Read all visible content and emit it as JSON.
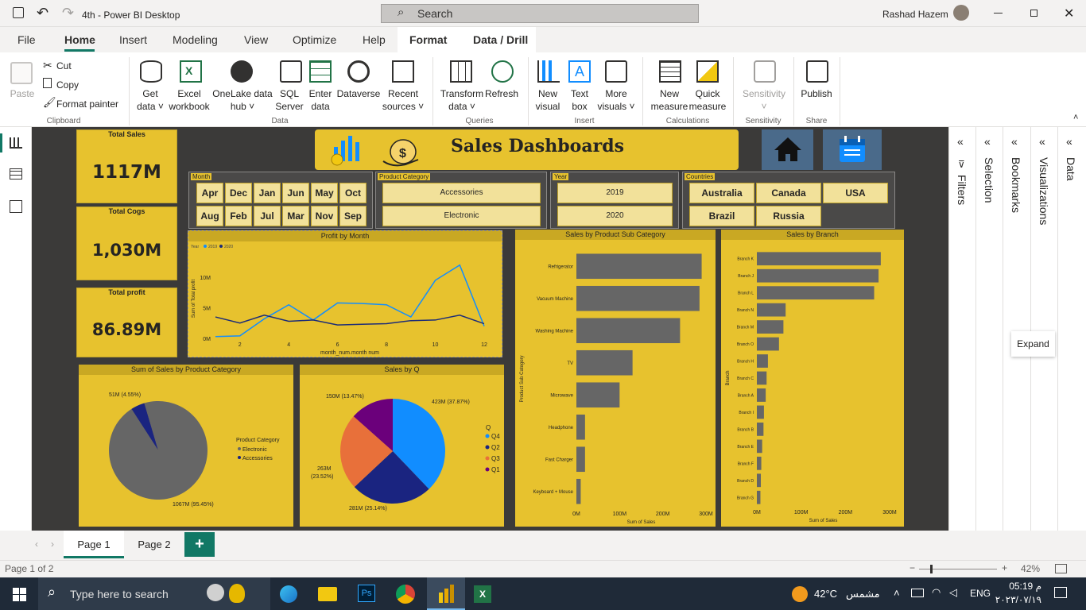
{
  "window": {
    "title": "4th - Power BI Desktop",
    "search_placeholder": "Search",
    "user": "Rashad Hazem"
  },
  "menu": [
    "File",
    "Home",
    "Insert",
    "Modeling",
    "View",
    "Optimize",
    "Help",
    "Format",
    "Data / Drill"
  ],
  "ribbon": {
    "paste": "Paste",
    "cut": "Cut",
    "copy": "Copy",
    "format_painter": "Format painter",
    "clipboard": "Clipboard",
    "get_data": [
      "Get",
      "data ˅"
    ],
    "excel": [
      "Excel",
      "workbook"
    ],
    "onelake": [
      "OneLake data",
      "hub ˅"
    ],
    "sql": [
      "SQL",
      "Server"
    ],
    "enter": [
      "Enter",
      "data"
    ],
    "dataverse": [
      "Dataverse"
    ],
    "recent": [
      "Recent",
      "sources ˅"
    ],
    "data": "Data",
    "transform": [
      "Transform",
      "data ˅"
    ],
    "refresh": [
      "Refresh"
    ],
    "queries": "Queries",
    "new_visual": [
      "New",
      "visual"
    ],
    "text_box": [
      "Text",
      "box"
    ],
    "more_visuals": [
      "More",
      "visuals ˅"
    ],
    "insert": "Insert",
    "new_measure": [
      "New",
      "measure"
    ],
    "quick_measure": [
      "Quick",
      "measure"
    ],
    "calculations": "Calculations",
    "sensitivity_btn": [
      "Sensitivity",
      "˅"
    ],
    "sensitivity": "Sensitivity",
    "publish": [
      "Publish"
    ],
    "share": "Share"
  },
  "kpis": [
    {
      "label": "Total Sales",
      "value": "1117M"
    },
    {
      "label": "Total Cogs",
      "value": "1,030M"
    },
    {
      "label": "Total profit",
      "value": "86.89M"
    }
  ],
  "banner": {
    "title": "Sales Dashboards"
  },
  "slicers": {
    "month": {
      "label": "Month",
      "items": [
        "Apr",
        "Dec",
        "Jan",
        "Jun",
        "May",
        "Oct",
        "Aug",
        "Feb",
        "Jul",
        "Mar",
        "Nov",
        "Sep"
      ]
    },
    "category": {
      "label": "Product Category",
      "items": [
        "Accessories",
        "Electronic"
      ]
    },
    "year": {
      "label": "Year",
      "items": [
        "2019",
        "2020"
      ]
    },
    "countries": {
      "label": "Countries",
      "items": [
        "Australia",
        "Canada",
        "USA",
        "Brazil",
        "Russia"
      ]
    }
  },
  "chart_data": [
    {
      "type": "line",
      "title": "Profit by Month",
      "xlabel": "month_num.month num",
      "ylabel": "Sum of Total profit",
      "legend_title": "Year",
      "x": [
        1,
        2,
        3,
        4,
        5,
        6,
        7,
        8,
        9,
        10,
        11,
        12
      ],
      "x_ticks": [
        "2",
        "4",
        "6",
        "8",
        "10",
        "12"
      ],
      "y_ticks": [
        "0M",
        "5M",
        "10M"
      ],
      "ylim": [
        0,
        13
      ],
      "series": [
        {
          "name": "2019",
          "color": "#118dff",
          "values": [
            0.3,
            0.4,
            3.2,
            5.5,
            3.0,
            5.8,
            5.7,
            5.5,
            3.5,
            9.5,
            12.0,
            2.0
          ]
        },
        {
          "name": "2020",
          "color": "#1c2c78",
          "values": [
            3.5,
            2.5,
            3.8,
            2.8,
            3.0,
            2.2,
            2.3,
            2.4,
            2.9,
            3.0,
            3.8,
            2.4
          ]
        }
      ]
    },
    {
      "type": "bar",
      "title": "Sales by Product Sub Category",
      "xlabel": "Sum of Sales",
      "ylabel": "Product Sub Category",
      "categories": [
        "Refrigerator",
        "Vacuum Machine",
        "Washing Machine",
        "TV",
        "Microwave",
        "Headphone",
        "Fast Charger",
        "Keyboard + Mouse"
      ],
      "values": [
        290,
        285,
        240,
        130,
        100,
        20,
        20,
        10
      ],
      "x_ticks": [
        "0M",
        "100M",
        "200M",
        "300M"
      ],
      "xlim": [
        0,
        300
      ]
    },
    {
      "type": "bar",
      "title": "Sales by Branch",
      "xlabel": "Sum of Sales",
      "ylabel": "Branch",
      "categories": [
        "Branch K",
        "Branch J",
        "Branch L",
        "Branch N",
        "Branch M",
        "Branch O",
        "Branch H",
        "Branch C",
        "Branch A",
        "Branch I",
        "Branch B",
        "Branch E",
        "Branch F",
        "Branch D",
        "Branch G"
      ],
      "values": [
        280,
        275,
        265,
        65,
        60,
        50,
        25,
        22,
        20,
        16,
        15,
        12,
        10,
        9,
        8
      ],
      "x_ticks": [
        "0M",
        "100M",
        "200M",
        "300M"
      ],
      "xlim": [
        0,
        300
      ]
    },
    {
      "type": "pie",
      "title": "Sum of Sales by Product Category",
      "legend_title": "Product Category",
      "labels": [
        "Electronic",
        "Accessories"
      ],
      "values": [
        1067,
        51
      ],
      "data_labels": [
        "1067M (95.45%)",
        "51M (4.55%)"
      ],
      "colors": [
        "#666666",
        "#1a2480"
      ]
    },
    {
      "type": "pie",
      "title": "Sales by Q",
      "legend_title": "Q",
      "labels": [
        "Q4",
        "Q2",
        "Q3",
        "Q1"
      ],
      "values": [
        423,
        281,
        263,
        150
      ],
      "data_labels": [
        "423M (37.87%)",
        "281M (25.14%)",
        "263M (23.52%)",
        "150M (13.47%)"
      ],
      "colors": [
        "#118dff",
        "#1a2480",
        "#e8703a",
        "#6b007b"
      ]
    }
  ],
  "panes": [
    "Filters",
    "Selection",
    "Bookmarks",
    "Visualizations",
    "Data"
  ],
  "tooltip": "Expand",
  "pages": [
    "Page 1",
    "Page 2"
  ],
  "status": {
    "page": "Page 1 of 2",
    "zoom": "42%"
  },
  "taskbar": {
    "search": "Type here to search",
    "weather": "42°C",
    "weather_desc": "مشمس",
    "lang": "ENG",
    "time": "05:19 م",
    "date": "٢٠٢٣/٠٧/١٩"
  }
}
